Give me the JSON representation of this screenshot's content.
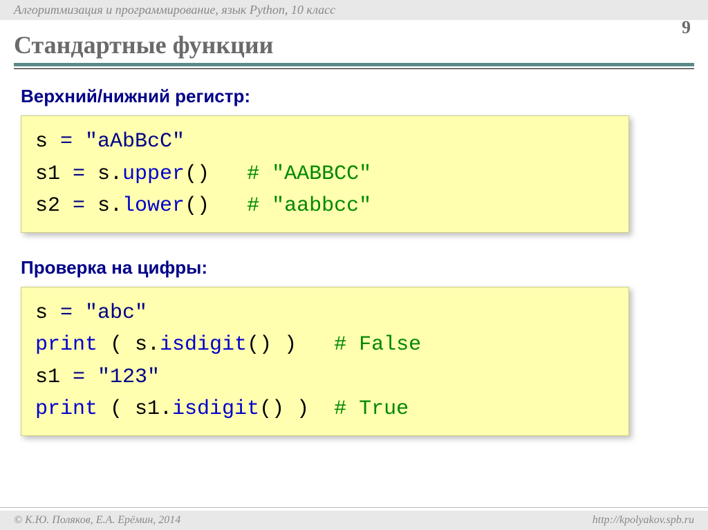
{
  "header": {
    "breadcrumb": "Алгоритмизация и программирование, язык Python, 10 класс"
  },
  "page_number": "9",
  "title": "Стандартные функции",
  "sections": [
    {
      "label": "Верхний/нижний регистр:",
      "code": [
        [
          {
            "cls": "c-black",
            "t": "s"
          },
          {
            "cls": "c-navy",
            "t": " = "
          },
          {
            "cls": "c-navy",
            "t": "\"aAbBcC\""
          }
        ],
        [
          {
            "cls": "c-black",
            "t": "s1"
          },
          {
            "cls": "c-navy",
            "t": " = "
          },
          {
            "cls": "c-black",
            "t": "s."
          },
          {
            "cls": "c-blue",
            "t": "upper"
          },
          {
            "cls": "c-black",
            "t": "()   "
          },
          {
            "cls": "c-green",
            "t": "# \"AABBCC\""
          }
        ],
        [
          {
            "cls": "c-black",
            "t": "s2"
          },
          {
            "cls": "c-navy",
            "t": " = "
          },
          {
            "cls": "c-black",
            "t": "s."
          },
          {
            "cls": "c-blue",
            "t": "lower"
          },
          {
            "cls": "c-black",
            "t": "()   "
          },
          {
            "cls": "c-green",
            "t": "# \"aabbcc\""
          }
        ]
      ]
    },
    {
      "label": "Проверка на цифры:",
      "code": [
        [
          {
            "cls": "c-black",
            "t": "s"
          },
          {
            "cls": "c-navy",
            "t": " = "
          },
          {
            "cls": "c-navy",
            "t": "\"abc\""
          }
        ],
        [
          {
            "cls": "c-blue",
            "t": "print"
          },
          {
            "cls": "c-black",
            "t": " ( s."
          },
          {
            "cls": "c-blue",
            "t": "isdigit"
          },
          {
            "cls": "c-black",
            "t": "() )   "
          },
          {
            "cls": "c-green",
            "t": "# False"
          }
        ],
        [
          {
            "cls": "c-black",
            "t": "s1"
          },
          {
            "cls": "c-navy",
            "t": " = "
          },
          {
            "cls": "c-navy",
            "t": "\"123\""
          }
        ],
        [
          {
            "cls": "c-blue",
            "t": "print"
          },
          {
            "cls": "c-black",
            "t": " ( s1."
          },
          {
            "cls": "c-blue",
            "t": "isdigit"
          },
          {
            "cls": "c-black",
            "t": "() )  "
          },
          {
            "cls": "c-green",
            "t": "# True"
          }
        ]
      ]
    }
  ],
  "footer": {
    "left": "© К.Ю. Поляков, Е.А. Ерёмин, 2014",
    "right": "http://kpolyakov.spb.ru"
  }
}
